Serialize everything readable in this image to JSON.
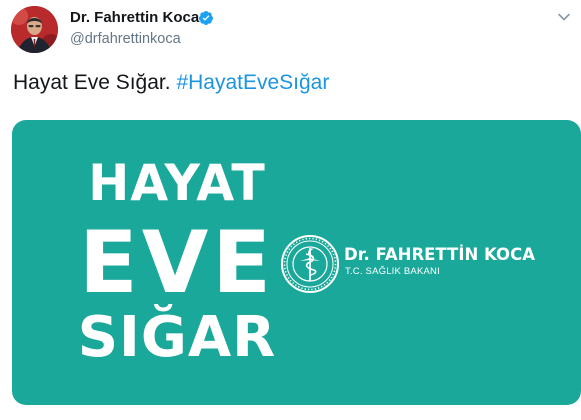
{
  "author": {
    "name": "Dr. Fahrettin Koca",
    "handle": "@drfahrettinkoca",
    "verified": true
  },
  "tweet": {
    "text": "Hayat Eve Sığar.",
    "hashtag": "#HayatEveSığar"
  },
  "media": {
    "background_color": "#1aa89a",
    "headline_line1": "HAYAT",
    "headline_line2": "EVE",
    "headline_line3": "SIĞAR",
    "brand_name": "Dr. FAHRETTİN KOCA",
    "brand_subtitle": "T.C. SAĞLIK BAKANI"
  },
  "icons": {
    "verified": "verified-badge-icon",
    "menu": "chevron-down-icon",
    "seal": "ministry-seal-icon"
  },
  "colors": {
    "link": "#1b95e0",
    "verified": "#1da1f2",
    "handle": "#657786",
    "text": "#14171a"
  }
}
